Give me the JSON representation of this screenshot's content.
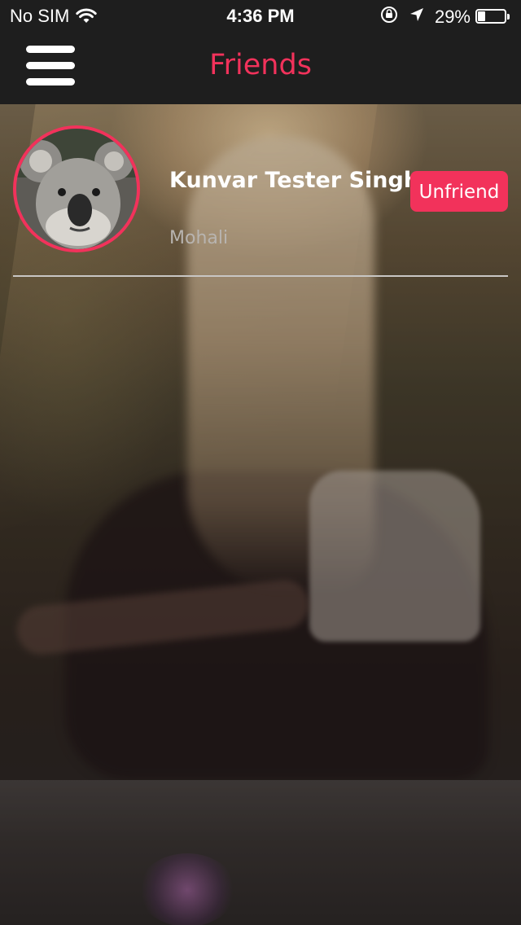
{
  "status_bar": {
    "carrier": "No SIM",
    "time": "4:36 PM",
    "battery_percent_label": "29%",
    "battery_level": 0.29,
    "icons": [
      "wifi-icon",
      "orientation-lock-icon",
      "location-arrow-icon",
      "battery-icon"
    ]
  },
  "nav": {
    "title": "Friends",
    "menu_icon": "hamburger-menu-icon",
    "title_color": "#f2325b"
  },
  "friends": [
    {
      "name": "Kunvar Tester Singh",
      "city": "Mohali",
      "action_label": "Unfriend",
      "avatar": "koala-avatar"
    }
  ],
  "colors": {
    "accent": "#f2325b",
    "bar_background": "#1e1e1e",
    "text_primary": "#ffffff",
    "text_secondary": "#b8b4b0"
  }
}
